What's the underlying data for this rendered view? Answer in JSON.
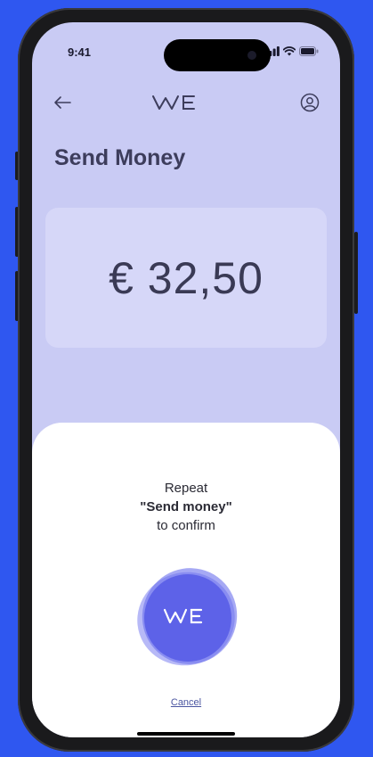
{
  "status_bar": {
    "time": "9:41"
  },
  "nav": {
    "back_icon": "arrow-left-icon",
    "logo_text": "WE",
    "profile_icon": "user-circle-icon"
  },
  "page": {
    "title": "Send Money"
  },
  "amount": {
    "display": "€ 32,50"
  },
  "confirm_sheet": {
    "line1": "Repeat",
    "phrase": "\"Send money\"",
    "line3": "to confirm",
    "orb_logo": "WE",
    "cancel_label": "Cancel"
  },
  "colors": {
    "background": "#2f57f0",
    "screen_bg": "#c9cbf4",
    "card_bg": "#d6d7f8",
    "orb": "#5d62e8",
    "text_dark": "#3d3d5c"
  }
}
